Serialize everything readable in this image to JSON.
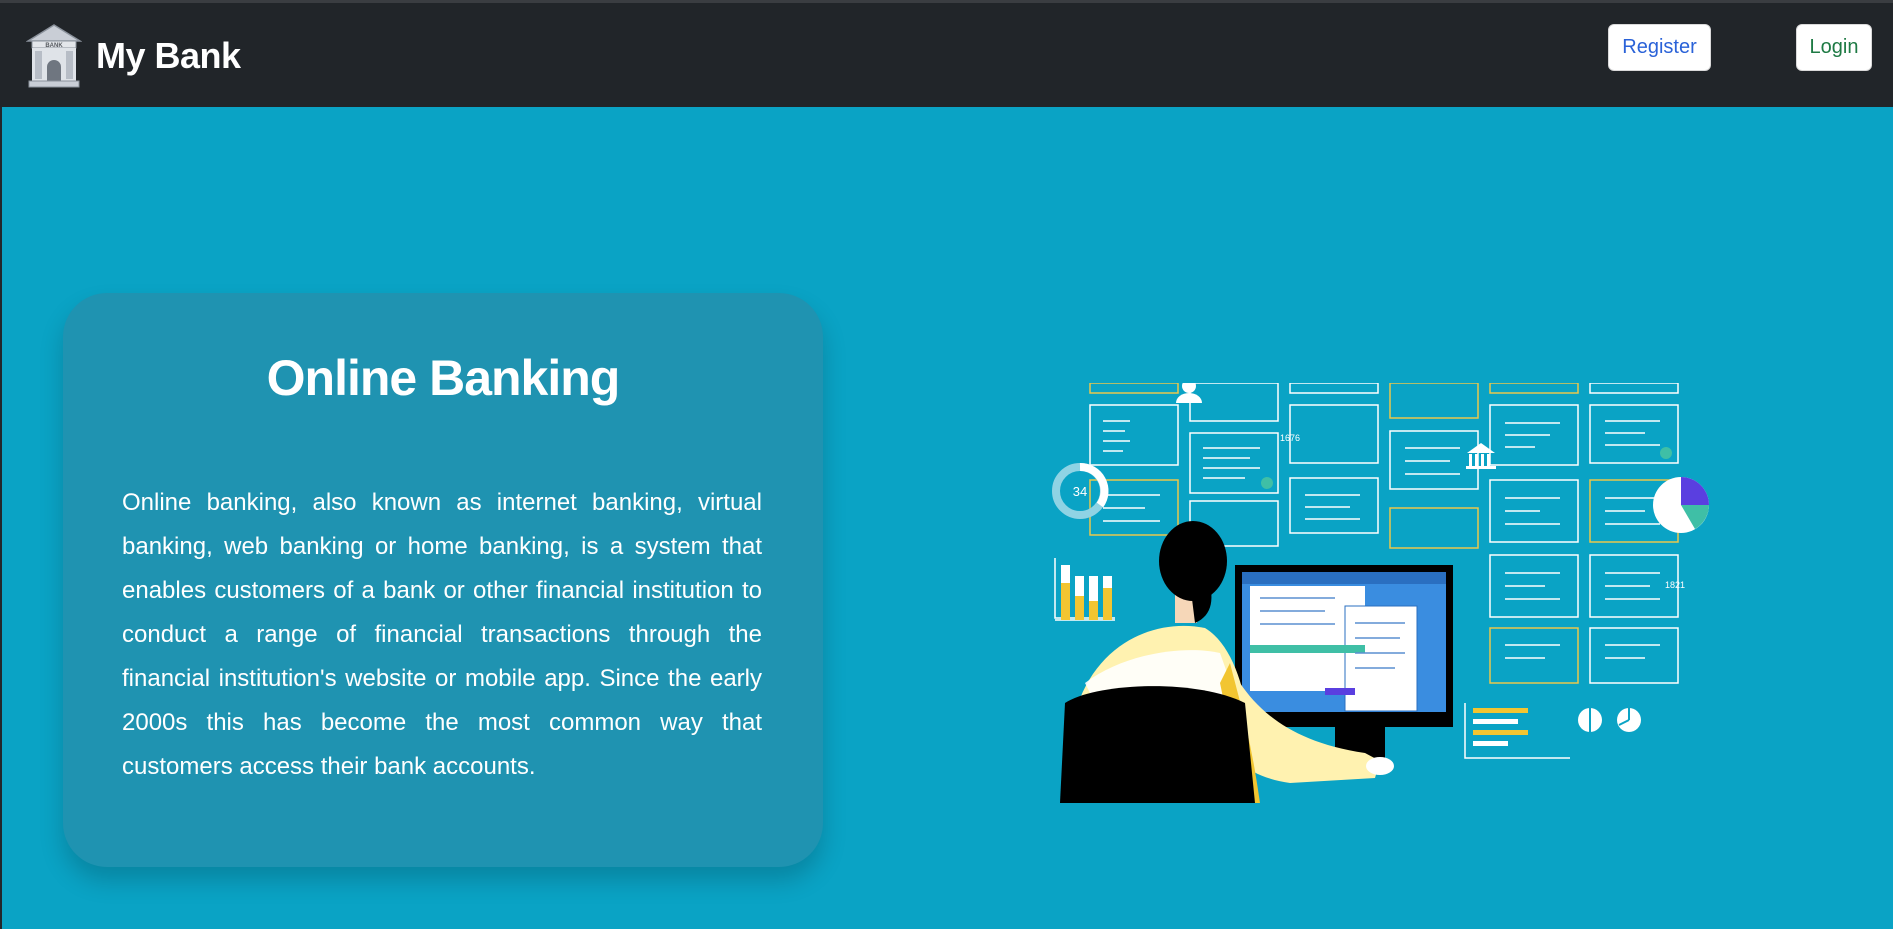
{
  "navbar": {
    "brand_name": "My Bank",
    "logo_icon": "bank-building-icon",
    "logo_text": "BANK",
    "register_label": "Register",
    "login_label": "Login"
  },
  "hero": {
    "title": "Online Banking",
    "body": "Online banking, also known as internet banking, virtual banking, web banking or home banking, is a system that enables customers of a bank or other financial institution to conduct a range of financial transactions through the financial institution's website or mobile app. Since the early 2000s this has become the most common way that customers access their bank accounts."
  },
  "illustration": {
    "gauge_value": "34",
    "number_a": "1676",
    "number_b": "1821"
  },
  "colors": {
    "navbar_bg": "#212529",
    "page_bg": "#0aa3c5",
    "card_bg": "#1f93b1",
    "register_text": "#2a62d8",
    "login_text": "#1e7a44"
  }
}
